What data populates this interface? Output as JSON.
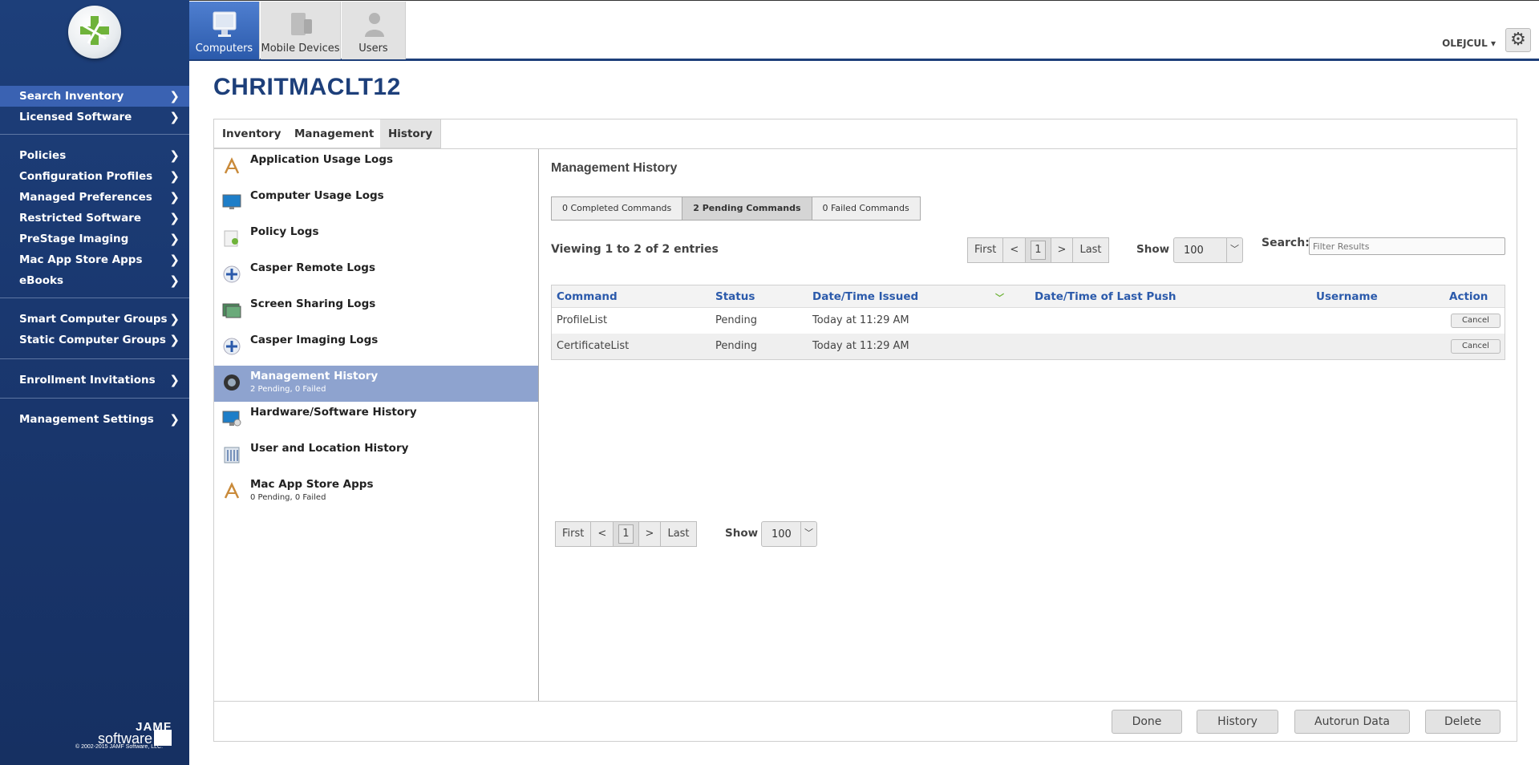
{
  "sidebar": {
    "logo_icon": "jamf-logo-icon",
    "groups": [
      [
        {
          "label": "Search Inventory",
          "active": true
        },
        {
          "label": "Licensed Software"
        }
      ],
      [
        {
          "label": "Policies"
        },
        {
          "label": "Configuration Profiles"
        },
        {
          "label": "Managed Preferences"
        },
        {
          "label": "Restricted Software"
        },
        {
          "label": "PreStage Imaging"
        },
        {
          "label": "Mac App Store Apps"
        },
        {
          "label": "eBooks"
        }
      ],
      [
        {
          "label": "Smart Computer Groups"
        },
        {
          "label": "Static Computer Groups"
        }
      ],
      [
        {
          "label": "Enrollment Invitations"
        }
      ],
      [
        {
          "label": "Management Settings"
        }
      ]
    ],
    "brand_top": "JAMF",
    "brand_bottom": "software",
    "copyright": "© 2002-2015 JAMF Software, LLC."
  },
  "topnav": {
    "tabs": [
      {
        "label": "Computers",
        "icon": "computer-icon",
        "active": true
      },
      {
        "label": "Mobile Devices",
        "icon": "mobile-devices-icon"
      },
      {
        "label": "Users",
        "icon": "user-icon"
      }
    ],
    "username": "OLEJCUL ▾",
    "settings_icon": "gear-icon"
  },
  "page": {
    "title": "CHRITMACLT12",
    "tabs": [
      "Inventory",
      "Management",
      "History"
    ],
    "selected_tab": "History"
  },
  "history_list": [
    {
      "title": "Application Usage Logs",
      "icon": "app-store-icon"
    },
    {
      "title": "Computer Usage Logs",
      "icon": "monitor-icon"
    },
    {
      "title": "Policy Logs",
      "icon": "policy-icon"
    },
    {
      "title": "Casper Remote Logs",
      "icon": "casper-icon"
    },
    {
      "title": "Screen Sharing Logs",
      "icon": "screen-sharing-icon"
    },
    {
      "title": "Casper Imaging Logs",
      "icon": "casper-icon"
    },
    {
      "title": "Management History",
      "subtitle": "2 Pending, 0 Failed",
      "icon": "management-icon",
      "selected": true
    },
    {
      "title": "Hardware/Software History",
      "icon": "hardware-icon"
    },
    {
      "title": "User and Location History",
      "icon": "building-icon"
    },
    {
      "title": "Mac App Store Apps",
      "subtitle": "0 Pending, 0 Failed",
      "icon": "app-store-icon"
    }
  ],
  "management": {
    "title": "Management History",
    "segments": [
      {
        "label": "0 Completed Commands"
      },
      {
        "label": "2 Pending Commands",
        "selected": true
      },
      {
        "label": "0 Failed Commands"
      }
    ],
    "viewing": "Viewing 1 to 2 of 2 entries",
    "pager": {
      "first": "First",
      "prev": "<",
      "page": "1",
      "next": ">",
      "last": "Last"
    },
    "show_label": "Show",
    "show_value": "100",
    "search_label": "Search:",
    "search_placeholder": "Filter Results",
    "columns": [
      "Command",
      "Status",
      "Date/Time Issued",
      "Date/Time of Last Push",
      "Username",
      "Action"
    ],
    "sort_icon": "chevron-down-icon",
    "rows": [
      {
        "command": "ProfileList",
        "status": "Pending",
        "issued": "Today at 11:29 AM",
        "last_push": "",
        "username": "",
        "action": "Cancel"
      },
      {
        "command": "CertificateList",
        "status": "Pending",
        "issued": "Today at 11:29 AM",
        "last_push": "",
        "username": "",
        "action": "Cancel"
      }
    ]
  },
  "footer": {
    "buttons": [
      "Done",
      "History",
      "Autorun Data",
      "Delete"
    ]
  }
}
